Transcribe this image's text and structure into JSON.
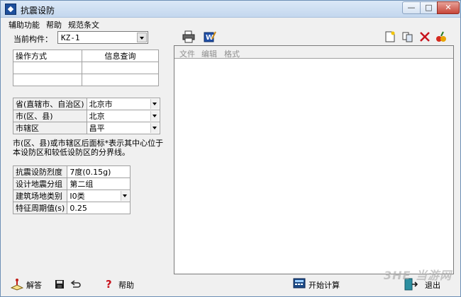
{
  "window": {
    "title": "抗震设防"
  },
  "menu": [
    "辅助功能",
    "帮助",
    "规范条文"
  ],
  "component": {
    "label": "当前构件：",
    "value": "KZ-1"
  },
  "op_table": {
    "headers": [
      "操作方式",
      "信息查询"
    ]
  },
  "location": [
    {
      "key": "省(直辖市、自治区)",
      "value": "北京市"
    },
    {
      "key": "市(区、县)",
      "value": "北京"
    },
    {
      "key": "市辖区",
      "value": "昌平"
    }
  ],
  "note": "市(区、县)或市辖区后面标*表示其中心位于本设防区和较低设防区的分界线。",
  "seismic": [
    {
      "key": "抗震设防烈度",
      "value": "7度(0.15g)"
    },
    {
      "key": "设计地震分组",
      "value": "第二组"
    },
    {
      "key": "建筑场地类别",
      "value": "Ⅰ0类"
    },
    {
      "key": "特征周期值(s)",
      "value": "0.25"
    }
  ],
  "editor_menu": [
    "文件",
    "编辑",
    "格式"
  ],
  "bottom": {
    "explain": "解答",
    "help": "帮助",
    "start": "开始计算",
    "exit": "退出"
  },
  "watermark": "3HE 当游网",
  "colors": {
    "accent": "#1d4f9c",
    "close": "#c7463a"
  }
}
